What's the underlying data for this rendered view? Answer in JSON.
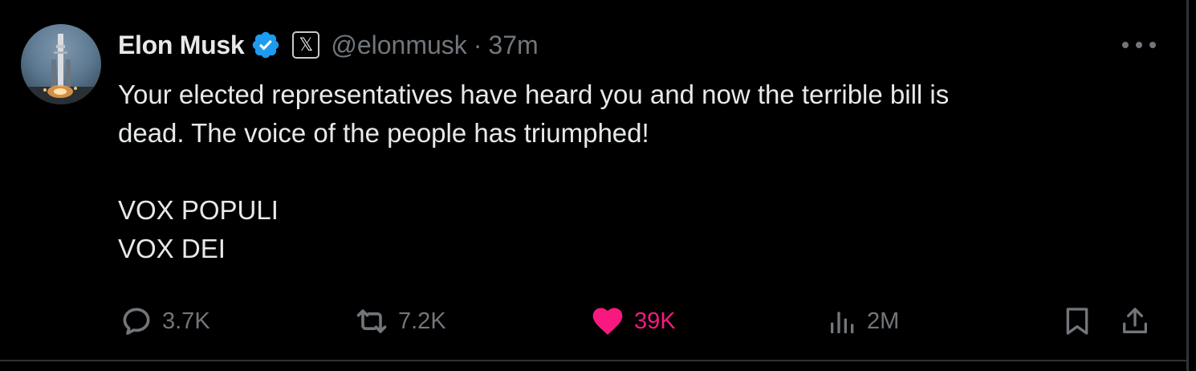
{
  "author": {
    "name": "Elon Musk",
    "handle": "@elonmusk",
    "separator": "·",
    "time": "37m",
    "verified_color": "#1d9bf0",
    "badge_icon": "x-logo-icon"
  },
  "tweet": {
    "line1": "Your elected representatives have heard you and now the terrible bill is",
    "line2": "dead. The voice of the people has triumphed!",
    "line3": "VOX POPULI",
    "line4": "VOX DEI"
  },
  "actions": {
    "replies": "3.7K",
    "reposts": "7.2K",
    "likes": "39K",
    "views": "2M",
    "like_color": "#f91880",
    "muted_color": "#71767b"
  }
}
